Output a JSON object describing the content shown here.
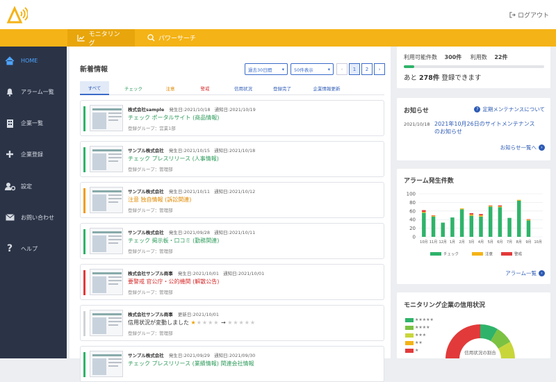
{
  "header": {
    "logout_label": "ログアウト"
  },
  "tabs": {
    "monitoring": "モニタリング",
    "power_search": "パワーサーチ"
  },
  "sidebar": {
    "items": [
      {
        "label": "HOME",
        "icon": "home-icon"
      },
      {
        "label": "アラーム一覧",
        "icon": "bell-icon"
      },
      {
        "label": "企業一覧",
        "icon": "building-icon"
      },
      {
        "label": "企業登録",
        "icon": "plus-icon"
      },
      {
        "label": "設定",
        "icon": "user-gear-icon"
      },
      {
        "label": "お問い合わせ",
        "icon": "envelope-icon"
      },
      {
        "label": "ヘルプ",
        "icon": "question-icon"
      }
    ]
  },
  "news": {
    "title": "新着情報",
    "period": "過去30日間",
    "per_page": "50件表示",
    "pages": [
      "1",
      "2"
    ],
    "filter_tabs": [
      "すべて",
      "チェック",
      "注意",
      "警戒",
      "信用状況",
      "登録完了",
      "企業情報更新"
    ],
    "cards": [
      {
        "company": "株式会社sample",
        "meta1": "発生日:2021/10/18",
        "meta2": "通知日:2021/10/19",
        "title": "チェック ポータルサイト (商品情報)",
        "group": "登録グループ：営業1部",
        "level": "check"
      },
      {
        "company": "サンプル株式会社",
        "meta1": "発生日:2021/10/15",
        "meta2": "通知日:2021/10/18",
        "title": "チェック プレスリリース (人事情報)",
        "group": "登録グループ：管理部",
        "level": "check"
      },
      {
        "company": "サンプル株式会社",
        "meta1": "発生日:2021/10/11",
        "meta2": "通知日:2021/10/12",
        "title": "注意 独自情報 (訴訟関連)",
        "group": "登録グループ：管理部",
        "level": "caution"
      },
      {
        "company": "サンプル株式会社",
        "meta1": "発生日:2021/09/28",
        "meta2": "通知日:2021/10/11",
        "title": "チェック 掲示板・口コミ (勤務関連)",
        "group": "登録グループ：管理部",
        "level": "check"
      },
      {
        "company": "株式会社サンプル商事",
        "meta1": "発生日:2021/10/01",
        "meta2": "通知日:2021/10/01",
        "title": "要警戒 官公庁・公的機関 (解散公告)",
        "group": "登録グループ：管理部",
        "level": "alert"
      },
      {
        "company": "株式会社サンプル商事",
        "meta1": "更新日:2021/10/01",
        "meta2": "",
        "title": "信用状況が変動しました",
        "group": "登録グループ：管理部",
        "level": "credit"
      },
      {
        "company": "サンプル株式会社",
        "meta1": "発生日:2021/09/29",
        "meta2": "通知日:2021/09/30",
        "title": "チェック プレスリリース (業績情報) 関連会社情報",
        "group": "",
        "level": "check"
      }
    ]
  },
  "usage": {
    "available_label": "利用可能件数",
    "available_value": "300件",
    "used_label": "利用数",
    "used_value": "22件",
    "remaining_prefix": "あと",
    "remaining_value": "278件",
    "remaining_suffix": "登録できます",
    "progress_fraction": 0.073
  },
  "notices": {
    "title": "お知らせ",
    "maintenance_link": "定期メンテナンスについて",
    "date": "2021/10/18",
    "text": "2021年10月26日のサイトメンテナンスのお知らせ",
    "more_link": "お知らせ一覧へ"
  },
  "alarm_panel": {
    "title": "アラーム発生件数",
    "more_link": "アラーム一覧"
  },
  "chart_data": {
    "type": "bar",
    "stacked": true,
    "categories": [
      "10月",
      "11月",
      "12月",
      "1月",
      "2月",
      "3月",
      "4月",
      "5月",
      "6月",
      "7月",
      "8月",
      "9月",
      "10月"
    ],
    "series": [
      {
        "name": "チェック",
        "color": "#2fb36a",
        "values": [
          56,
          47,
          33,
          45,
          64,
          49,
          47,
          70,
          69,
          44,
          84,
          38,
          0
        ]
      },
      {
        "name": "注意",
        "color": "#f4b316",
        "values": [
          2,
          2,
          0,
          0,
          2,
          3,
          3,
          2,
          2,
          0,
          2,
          2,
          0
        ]
      },
      {
        "name": "警戒",
        "color": "#e23a3a",
        "values": [
          4,
          1,
          0,
          0,
          0,
          3,
          3,
          1,
          2,
          0,
          0,
          1,
          0
        ]
      }
    ],
    "ylim": [
      0,
      100
    ],
    "yticks": [
      0,
      20,
      40,
      60,
      80,
      100
    ],
    "grid": true,
    "legend": "bottom"
  },
  "credit_panel": {
    "title": "モニタリング企業の信用状況",
    "center_text": "信用状況の割合",
    "legend": [
      {
        "stars": "★★★★★",
        "color": "#2fb36a"
      },
      {
        "stars": "★★★★",
        "color": "#7cc242"
      },
      {
        "stars": "★★★",
        "color": "#c8d63a"
      },
      {
        "stars": "★★",
        "color": "#f4b316"
      },
      {
        "stars": "★",
        "color": "#e23a3a"
      }
    ]
  }
}
